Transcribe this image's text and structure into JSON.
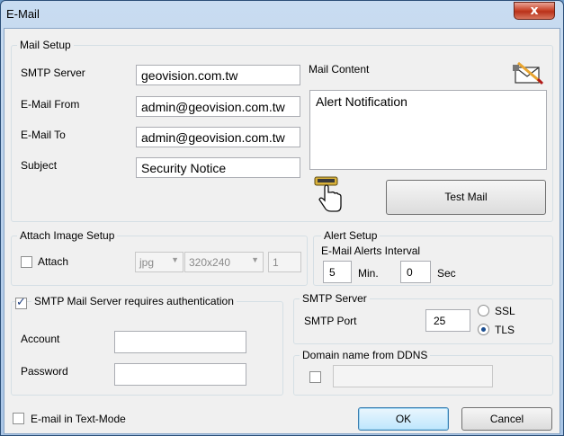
{
  "window": {
    "title": "E-Mail",
    "close_label": "x"
  },
  "mail_setup": {
    "title": "Mail Setup",
    "smtp_server_label": "SMTP Server",
    "smtp_server_value": "geovision.com.tw",
    "email_from_label": "E-Mail From",
    "email_from_value": "admin@geovision.com.tw",
    "email_to_label": "E-Mail To",
    "email_to_value": "admin@geovision.com.tw",
    "subject_label": "Subject",
    "subject_value": "Security Notice",
    "mail_content_label": "Mail Content",
    "mail_content_value": "Alert Notification",
    "test_mail_label": "Test Mail"
  },
  "attach_image": {
    "title": "Attach Image Setup",
    "attach_label": "Attach",
    "attach_checked": false,
    "format_value": "jpg",
    "resolution_value": "320x240",
    "count_value": "1"
  },
  "alert_setup": {
    "title": "Alert Setup",
    "interval_label": "E-Mail Alerts Interval",
    "minutes_value": "5",
    "minutes_unit": "Min.",
    "seconds_value": "0",
    "seconds_unit": "Sec"
  },
  "auth": {
    "title": "SMTP Mail Server requires authentication",
    "checked": true,
    "account_label": "Account",
    "account_value": "",
    "password_label": "Password",
    "password_value": ""
  },
  "smtp": {
    "title": "SMTP Server",
    "port_label": "SMTP Port",
    "port_value": "25",
    "ssl_label": "SSL",
    "tls_label": "TLS",
    "selected": "TLS"
  },
  "ddns": {
    "title": "Domain name from DDNS",
    "checked": false,
    "value": ""
  },
  "footer": {
    "text_mode_label": "E-mail in Text-Mode",
    "text_mode_checked": false,
    "ok_label": "OK",
    "cancel_label": "Cancel"
  },
  "icons": [
    "mail-edit-icon",
    "hand-pointer-icon"
  ]
}
